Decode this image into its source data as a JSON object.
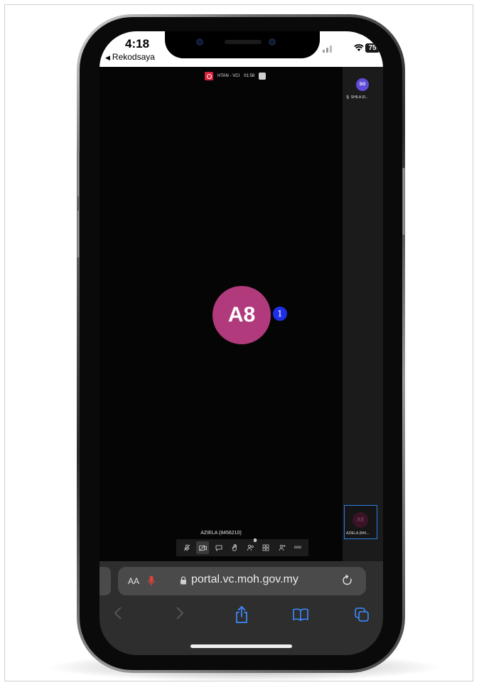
{
  "status_bar": {
    "time": "4:18",
    "back_app": "Rekodsaya",
    "battery": "75"
  },
  "meeting": {
    "title": "HTAN - VCI",
    "duration": "01:58",
    "rail_participant": {
      "initials": "SO",
      "name": "SHILA (0..."
    },
    "main_participant": {
      "initials": "A8",
      "badge": "1"
    },
    "self_tile": {
      "initials": "A8",
      "name": "AZIELA (845..."
    },
    "speaker_label": "AZIELA (8456210)",
    "toolbar": {
      "buttons": [
        "mic-muted",
        "camera-off",
        "chat",
        "raise-hand",
        "participants",
        "tile-view",
        "invite",
        "more"
      ],
      "participants_count": "2",
      "more_label": "ooo"
    }
  },
  "safari": {
    "text_size_label": "AA",
    "url": "portal.vc.moh.gov.my"
  },
  "colors": {
    "avatar_main": "#b13a7d",
    "avatar_rail": "#5e4bd6",
    "badge": "#1f2fe6",
    "record": "#d9213b",
    "safari_accent": "#3d8bff"
  }
}
